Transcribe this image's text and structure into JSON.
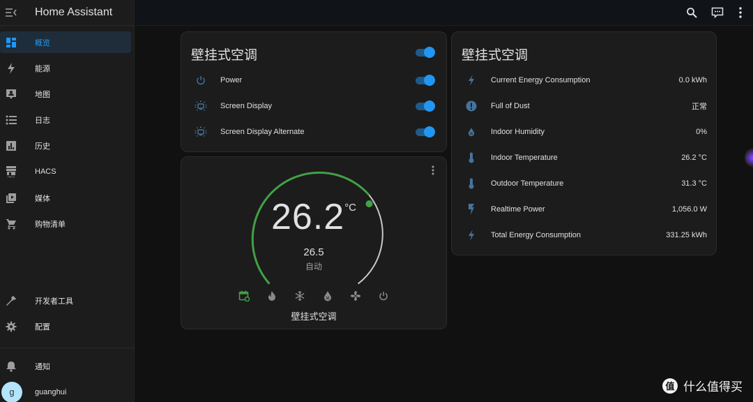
{
  "app": {
    "title": "Home Assistant"
  },
  "sidebar": {
    "items": [
      {
        "label": "概览",
        "icon": "view-dashboard-icon",
        "active": true
      },
      {
        "label": "能源",
        "icon": "lightning-bolt-icon"
      },
      {
        "label": "地图",
        "icon": "map-account-icon"
      },
      {
        "label": "日志",
        "icon": "format-list-bulleted-icon"
      },
      {
        "label": "历史",
        "icon": "chart-box-icon"
      },
      {
        "label": "HACS",
        "icon": "hacs-store-icon"
      },
      {
        "label": "媒体",
        "icon": "play-box-multiple-icon"
      },
      {
        "label": "购物清单",
        "icon": "cart-icon"
      }
    ],
    "bottom_items": [
      {
        "label": "开发者工具",
        "icon": "hammer-icon"
      },
      {
        "label": "配置",
        "icon": "cog-icon"
      }
    ],
    "notifications_label": "通知",
    "user": {
      "name": "guanghui",
      "initial": "g"
    }
  },
  "topbar": {
    "icons": [
      "search-icon",
      "assist-chat-icon",
      "more-vertical-icon"
    ]
  },
  "entities_card": {
    "title": "壁挂式空调",
    "master_toggle": true,
    "rows": [
      {
        "label": "Power",
        "icon": "power-icon",
        "state": true
      },
      {
        "label": "Screen Display",
        "icon": "television-ambient-light-icon",
        "state": true
      },
      {
        "label": "Screen Display Alternate",
        "icon": "television-ambient-light-icon",
        "state": true
      }
    ]
  },
  "thermostat_card": {
    "current_temperature": "26.2",
    "unit": "°C",
    "target_temperature": "26.5",
    "mode_label": "自动",
    "name": "壁挂式空调",
    "modes": [
      {
        "name": "auto",
        "icon": "calendar-sync-icon",
        "active": true
      },
      {
        "name": "heat",
        "icon": "fire-icon"
      },
      {
        "name": "cool",
        "icon": "snowflake-icon"
      },
      {
        "name": "dry",
        "icon": "water-percent-icon"
      },
      {
        "name": "fan_only",
        "icon": "fan-icon"
      },
      {
        "name": "off",
        "icon": "power-icon"
      }
    ],
    "accent_color": "#43a047"
  },
  "sensors_card": {
    "title": "壁挂式空调",
    "rows": [
      {
        "label": "Current Energy Consumption",
        "value": "0.0 kWh",
        "icon": "lightning-bolt-icon"
      },
      {
        "label": "Full of Dust",
        "value": "正常",
        "icon": "alert-circle-icon"
      },
      {
        "label": "Indoor Humidity",
        "value": "0%",
        "icon": "water-percent-icon"
      },
      {
        "label": "Indoor Temperature",
        "value": "26.2 °C",
        "icon": "thermometer-icon"
      },
      {
        "label": "Outdoor Temperature",
        "value": "31.3 °C",
        "icon": "thermometer-icon"
      },
      {
        "label": "Realtime Power",
        "value": "1,056.0 W",
        "icon": "flash-icon"
      },
      {
        "label": "Total Energy Consumption",
        "value": "331.25 kWh",
        "icon": "lightning-bolt-icon"
      }
    ]
  },
  "watermark": {
    "logo": "值",
    "text": "什么值得买"
  },
  "colors": {
    "primary": "#2196f3",
    "icon_blue": "#44739e",
    "heat_green": "#43a047"
  }
}
